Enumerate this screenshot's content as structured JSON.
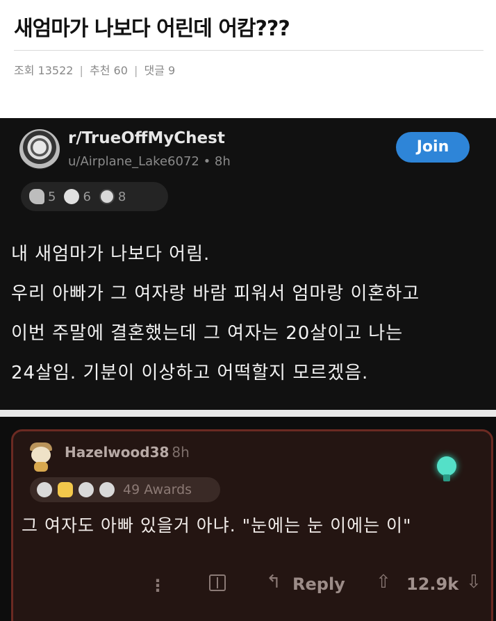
{
  "article": {
    "title": "새엄마가 나보다 어린데 어캄???",
    "views_label": "조회 13522",
    "recommend_label": "추천 60",
    "comments_label": "댓글 9",
    "separator": "|"
  },
  "post": {
    "subreddit": "r/TrueOffMyChest",
    "author_line": "u/Airplane_Lake6072 • 8h",
    "join_label": "Join",
    "awards": [
      {
        "icon": "award-wholesome-icon",
        "count": "5"
      },
      {
        "icon": "award-helpful-icon",
        "count": "6"
      },
      {
        "icon": "award-silver-icon",
        "count": "8"
      }
    ],
    "body_lines": [
      "내 새엄마가 나보다 어림.",
      "우리 아빠가 그 여자랑 바람 피워서 엄마랑 이혼하고",
      "이번 주말에 결혼했는데 그 여자는 20살이고 나는",
      "24살임. 기분이 이상하고 어떡할지 모르겠음."
    ]
  },
  "comment": {
    "username": "Hazelwood38",
    "time": "8h",
    "awards_label": "49 Awards",
    "text": "그 여자도 아빠 있을거 아냐. \"눈에는 눈 이에는 이\"",
    "more_label": "⋮",
    "reply_label": "Reply",
    "votes": "12.9k"
  },
  "colors": {
    "join_blue": "#2e85d8",
    "comment_border": "#6b2a22",
    "comment_bg": "#241512"
  }
}
